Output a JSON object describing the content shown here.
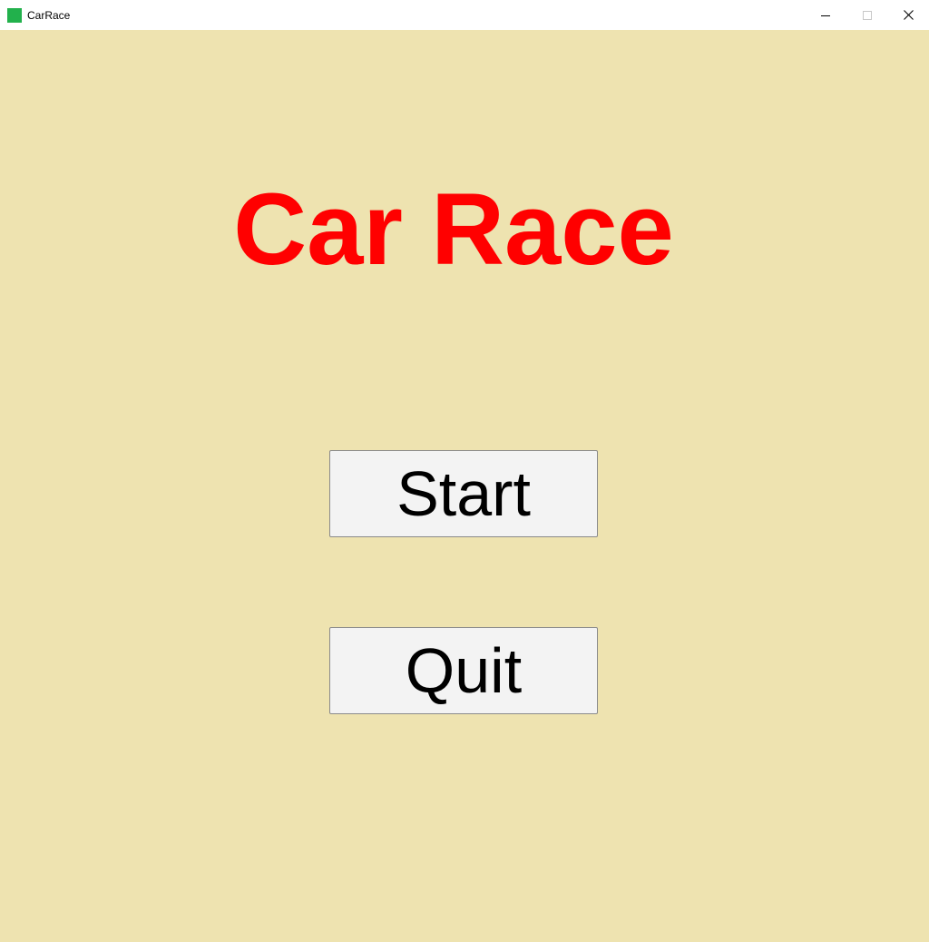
{
  "window": {
    "title": "CarRace",
    "app_icon_color": "#22b14c",
    "controls": {
      "minimize_icon": "minimize-icon",
      "maximize_icon": "maximize-icon",
      "close_icon": "close-icon"
    }
  },
  "main": {
    "title": "Car Race",
    "title_color": "#ff0000",
    "background_color": "#eee3b0",
    "buttons": {
      "start_label": "Start",
      "quit_label": "Quit"
    }
  }
}
